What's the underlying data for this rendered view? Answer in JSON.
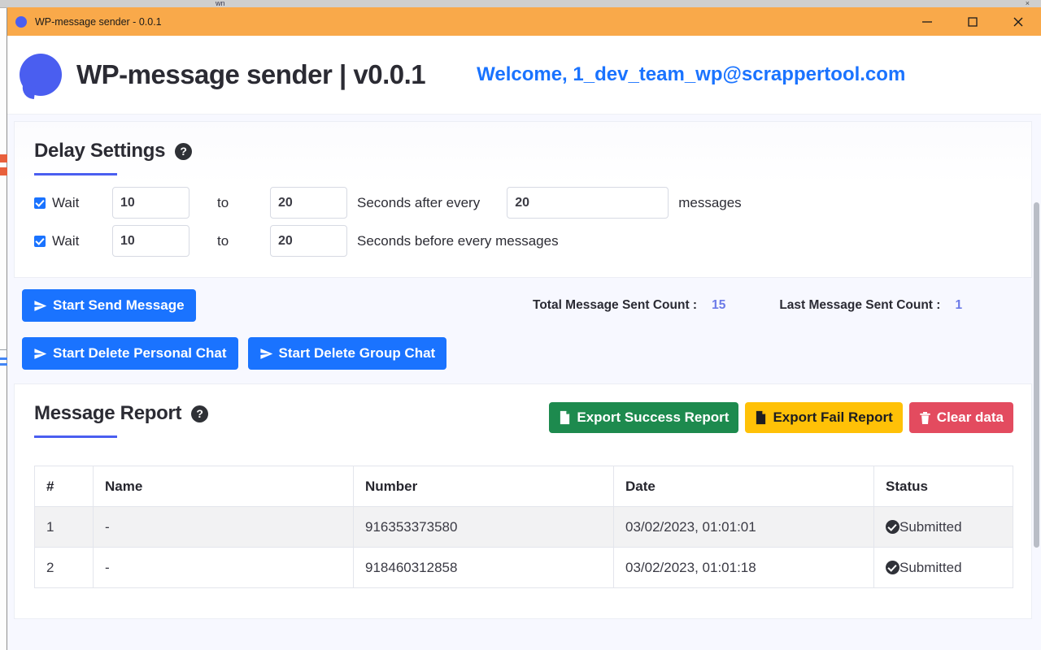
{
  "desktop": {
    "background_tab_label": "wn",
    "background_right_label": "×"
  },
  "titlebar": {
    "title": "WP-message sender - 0.0.1",
    "app_icon": "bubble-icon",
    "minimize_label": "minimize-icon",
    "maximize_label": "maximize-icon",
    "close_label": "close-icon",
    "background_color": "#f9a94a"
  },
  "header": {
    "logo": "speech-bubble-logo",
    "app_title": "WP-message sender | v0.0.1",
    "welcome": "Welcome, 1_dev_team_wp@scrappertool.com",
    "welcome_color": "#1a73ff"
  },
  "delay_settings": {
    "title": "Delay Settings",
    "help": "?",
    "rows": [
      {
        "checkbox_label": "Wait",
        "checked": true,
        "from_value": "10",
        "to_label": "to",
        "to_value": "20",
        "mid_text": "Seconds after every",
        "count_value": "20",
        "tail_text": "messages"
      },
      {
        "checkbox_label": "Wait",
        "checked": true,
        "from_value": "10",
        "to_label": "to",
        "to_value": "20",
        "mid_text": "Seconds before every messages"
      }
    ]
  },
  "actions": {
    "start_send_message": "Start Send Message",
    "start_delete_personal_chat": "Start Delete Personal Chat",
    "start_delete_group_chat": "Start Delete Group Chat",
    "button_color": "#1a73ff"
  },
  "counters": {
    "total_label": "Total Message Sent Count :",
    "total_value": "15",
    "last_label": "Last Message Sent Count :",
    "last_value": "1",
    "value_color": "#6b7ae8"
  },
  "report": {
    "title": "Message Report",
    "help": "?",
    "export_success": "Export Success Report",
    "export_fail": "Export Fail Report",
    "clear_data": "Clear data",
    "success_color": "#1d8a4e",
    "fail_color": "#ffc107",
    "clear_color": "#e34b5f",
    "columns": [
      "#",
      "Name",
      "Number",
      "Date",
      "Status"
    ],
    "rows": [
      {
        "index": "1",
        "name": "-",
        "number": "916353373580",
        "date": "03/02/2023, 01:01:01",
        "status": "Submitted"
      },
      {
        "index": "2",
        "name": "-",
        "number": "918460312858",
        "date": "03/02/2023, 01:01:18",
        "status": "Submitted"
      }
    ]
  }
}
